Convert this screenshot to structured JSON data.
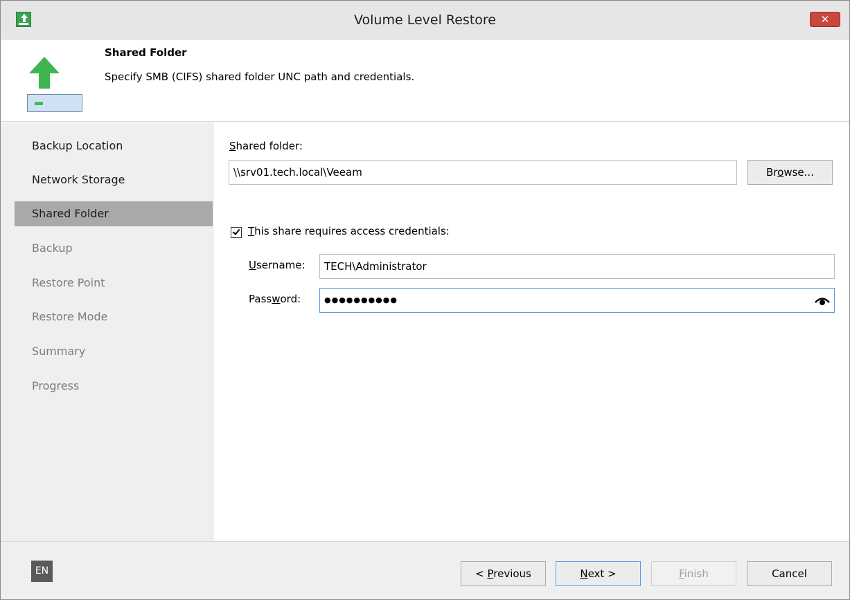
{
  "window": {
    "title": "Volume Level Restore",
    "close_label": "✕"
  },
  "header": {
    "title": "Shared Folder",
    "subtitle": "Specify SMB (CIFS) shared folder UNC path and credentials."
  },
  "sidebar": {
    "items": [
      {
        "label": "Backup Location",
        "state": "completed"
      },
      {
        "label": "Network Storage",
        "state": "completed"
      },
      {
        "label": "Shared Folder",
        "state": "active"
      },
      {
        "label": "Backup",
        "state": "disabled"
      },
      {
        "label": "Restore Point",
        "state": "disabled"
      },
      {
        "label": "Restore Mode",
        "state": "disabled"
      },
      {
        "label": "Summary",
        "state": "disabled"
      },
      {
        "label": "Progress",
        "state": "disabled"
      }
    ]
  },
  "form": {
    "shared_folder_label": {
      "before": "",
      "accel": "S",
      "after": "hared folder:"
    },
    "shared_folder_value": "\\\\srv01.tech.local\\Veeam",
    "browse_label": {
      "before": "Br",
      "accel": "o",
      "after": "wse..."
    },
    "credentials_checkbox": {
      "checked": true,
      "before": "",
      "accel": "T",
      "after": "his share requires access credentials:"
    },
    "username_label": {
      "before": "",
      "accel": "U",
      "after": "sername:"
    },
    "username_value": "TECH\\Administrator",
    "password_label": {
      "before": "Pass",
      "accel": "w",
      "after": "ord:"
    },
    "password_value": "●●●●●●●●●●"
  },
  "footer": {
    "language": "EN",
    "previous": {
      "before": "< ",
      "accel": "P",
      "after": "revious"
    },
    "next": {
      "before": "",
      "accel": "N",
      "after": "ext >"
    },
    "finish": {
      "before": "",
      "accel": "F",
      "after": "inish",
      "enabled": false
    },
    "cancel": "Cancel"
  },
  "colors": {
    "accent_green": "#3aa351",
    "close_red": "#c9473f",
    "focus_blue": "#569de5",
    "sidebar_active": "#a9a9a9"
  }
}
